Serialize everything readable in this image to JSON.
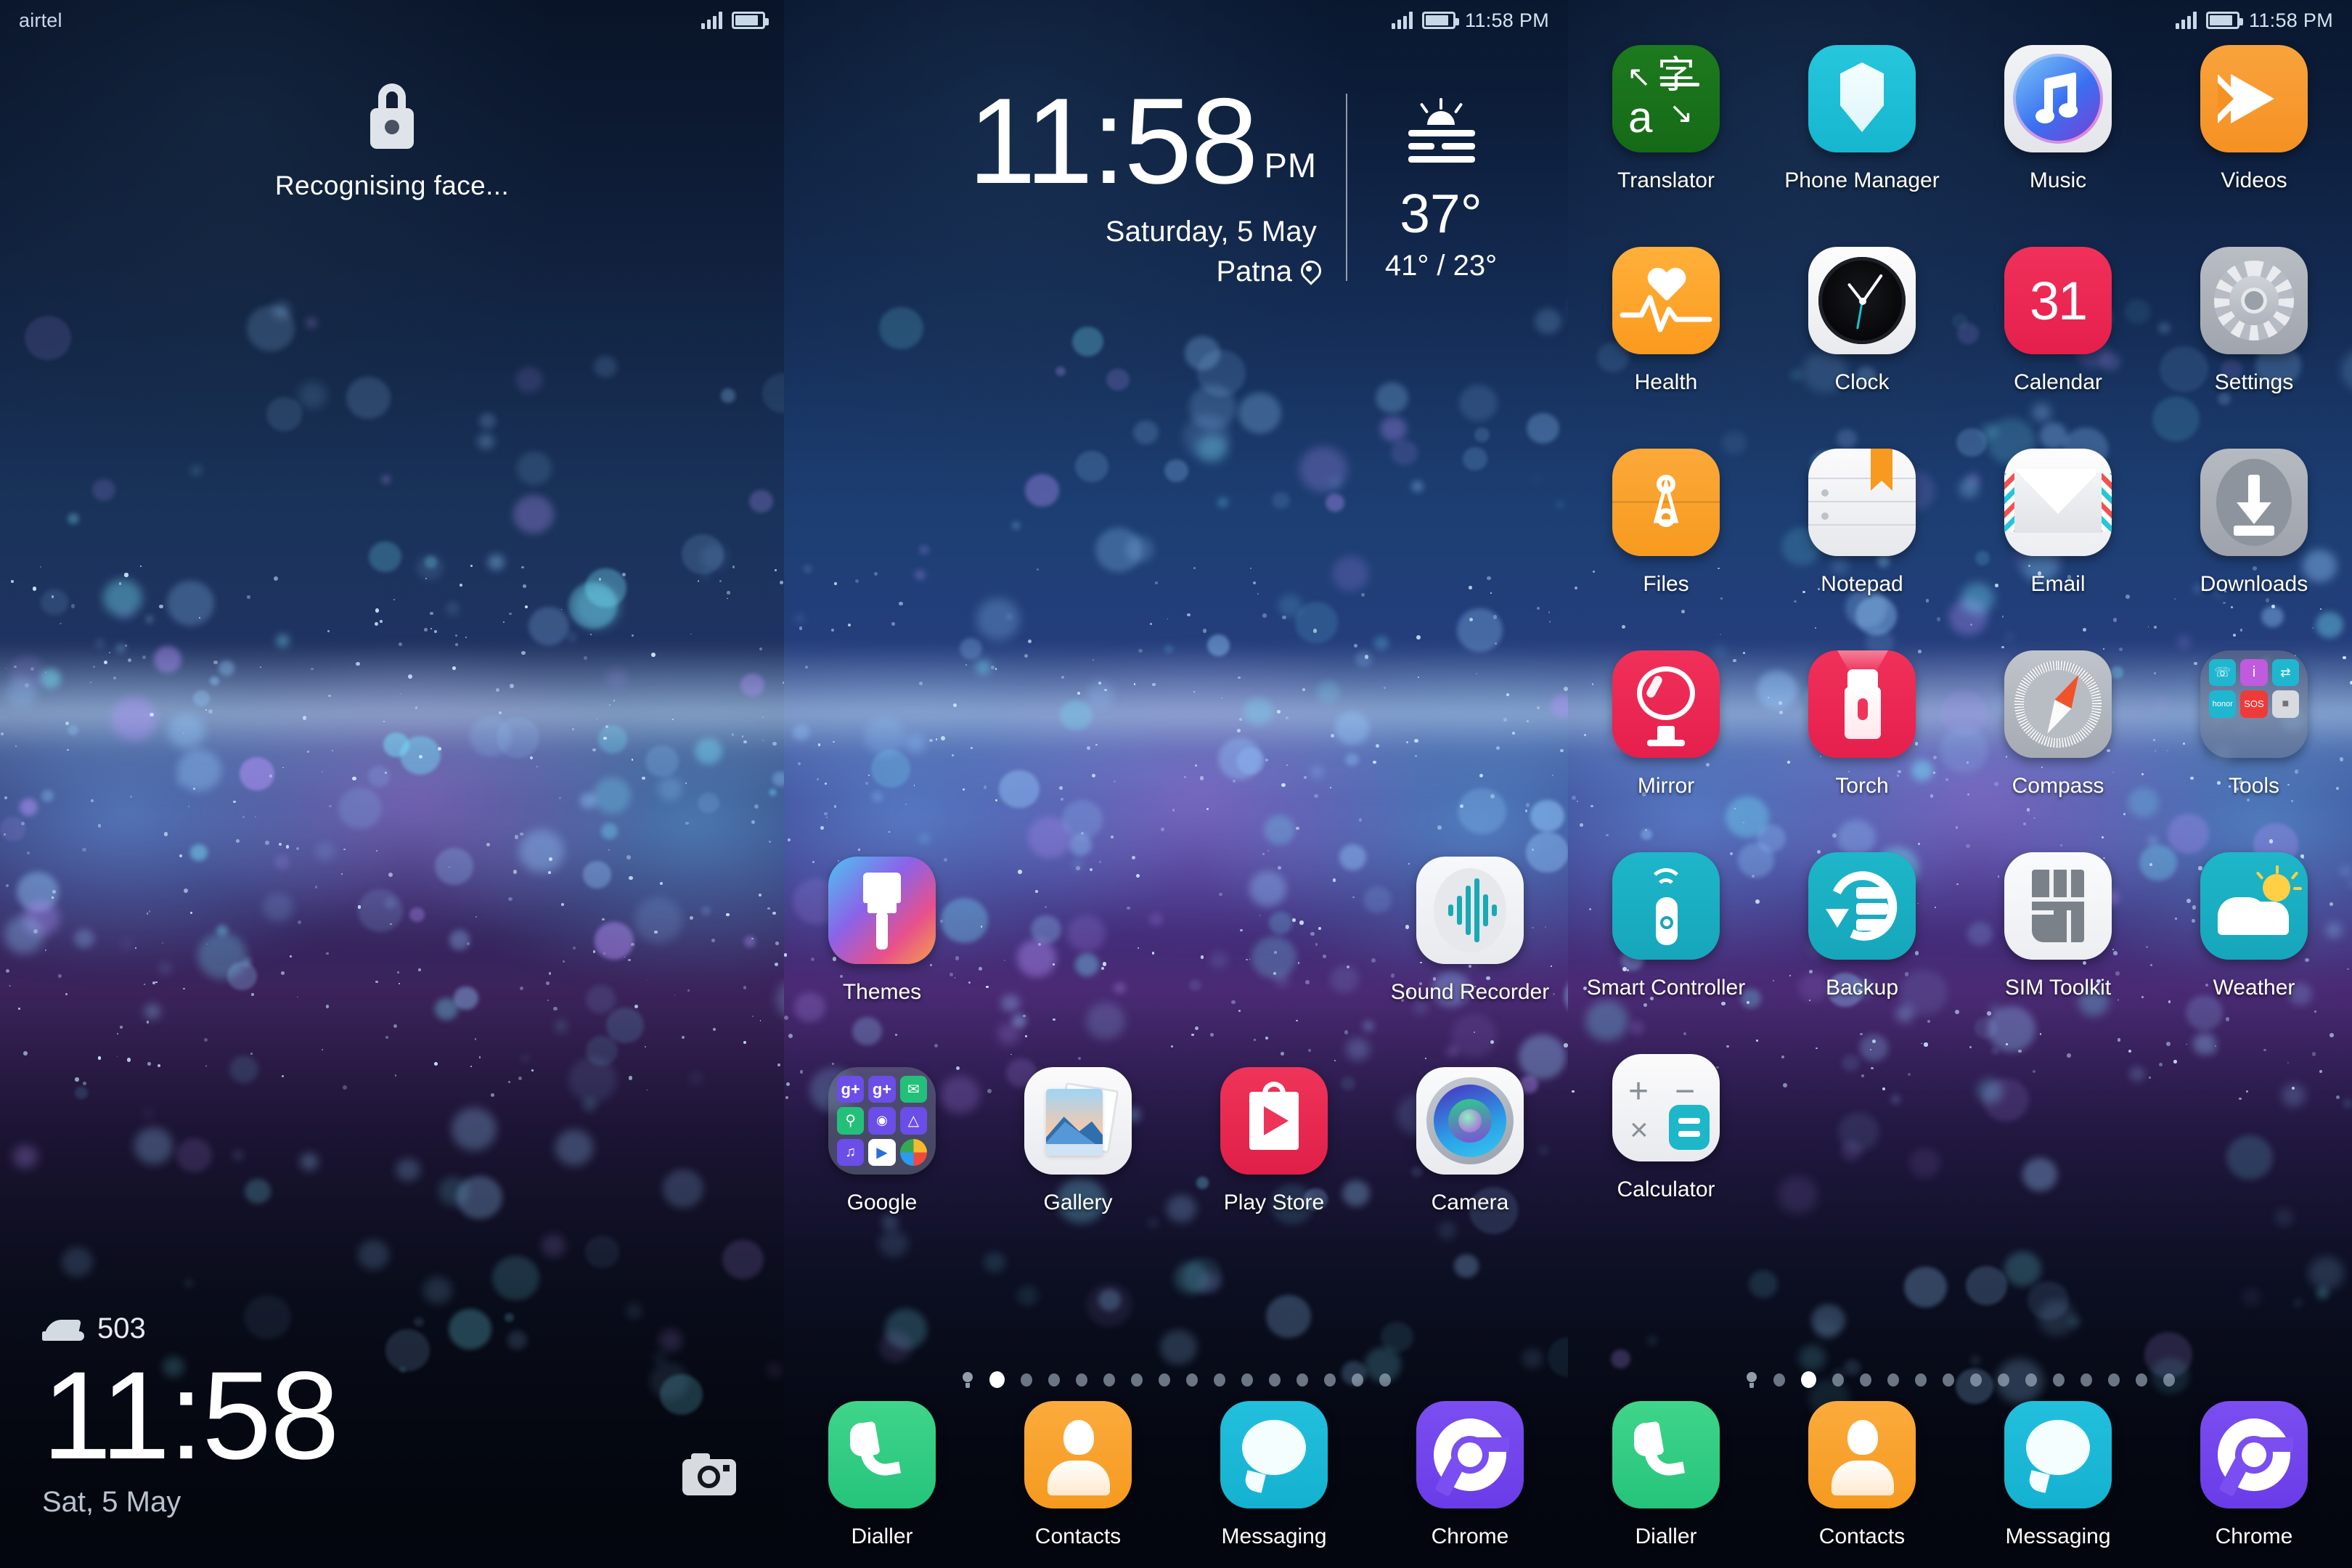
{
  "screens": [
    {
      "id": "lockscreen",
      "status_bar": {
        "carrier": "airtel",
        "signal_icon": "signal-bars-icon",
        "battery_icon": "battery-icon",
        "time": ""
      },
      "lock": {
        "lock_icon": "padlock-icon",
        "message": "Recognising face...",
        "steps_icon": "shoe-icon",
        "steps_count": "503",
        "clock": "11:58",
        "date": "Sat, 5 May",
        "camera_shortcut_icon": "camera-icon"
      }
    },
    {
      "id": "homescreen",
      "status_bar": {
        "carrier": "",
        "signal_icon": "signal-bars-icon",
        "battery_icon": "battery-icon",
        "time": "11:58 PM"
      },
      "widget": {
        "time": "11:58",
        "meridiem": "PM",
        "date": "Saturday, 5 May",
        "location": "Patna",
        "location_icon": "location-pin-icon",
        "weather_icon": "sunrise-haze-icon",
        "temperature": "37°",
        "range": "41° / 23°"
      },
      "apps": [
        {
          "label": "Themes",
          "icon": "themes-icon",
          "cls": "i-themes"
        },
        {
          "label": "",
          "icon": "",
          "cls": "empty"
        },
        {
          "label": "",
          "icon": "",
          "cls": "empty"
        },
        {
          "label": "Sound Recorder",
          "icon": "sound-recorder-icon",
          "cls": "i-sound"
        },
        {
          "label": "Google",
          "icon": "google-folder-icon",
          "cls": "i-gfolder"
        },
        {
          "label": "Gallery",
          "icon": "gallery-icon",
          "cls": "i-gallery"
        },
        {
          "label": "Play Store",
          "icon": "play-store-icon",
          "cls": "i-play"
        },
        {
          "label": "Camera",
          "icon": "camera-app-icon",
          "cls": "i-camera"
        }
      ],
      "page_indicator": {
        "home_icon": "bulb-icon",
        "total": 15,
        "active": 1
      },
      "dock": [
        {
          "label": "Dialler",
          "icon": "phone-handset-icon",
          "cls": "i-dialler"
        },
        {
          "label": "Contacts",
          "icon": "person-icon",
          "cls": "i-contacts"
        },
        {
          "label": "Messaging",
          "icon": "speech-bubble-icon",
          "cls": "i-msg"
        },
        {
          "label": "Chrome",
          "icon": "chrome-icon",
          "cls": "i-chrome"
        }
      ]
    },
    {
      "id": "homescreen-page2",
      "status_bar": {
        "carrier": "",
        "signal_icon": "signal-bars-icon",
        "battery_icon": "battery-icon",
        "time": "11:58 PM"
      },
      "apps": [
        {
          "label": "Translator",
          "icon": "translator-icon",
          "cls": "i-translator"
        },
        {
          "label": "Phone Manager",
          "icon": "shield-icon",
          "cls": "i-phonemgr"
        },
        {
          "label": "Music",
          "icon": "music-note-icon",
          "cls": "i-music"
        },
        {
          "label": "Videos",
          "icon": "play-arrow-icon",
          "cls": "i-videos"
        },
        {
          "label": "Health",
          "icon": "heart-pulse-icon",
          "cls": "i-health"
        },
        {
          "label": "Clock",
          "icon": "analog-clock-icon",
          "cls": "i-clock"
        },
        {
          "label": "Calendar",
          "icon": "calendar-31-icon",
          "cls": "i-calendar"
        },
        {
          "label": "Settings",
          "icon": "gear-icon",
          "cls": "i-settings"
        },
        {
          "label": "Files",
          "icon": "file-folder-icon",
          "cls": "i-files"
        },
        {
          "label": "Notepad",
          "icon": "notepad-icon",
          "cls": "i-notepad"
        },
        {
          "label": "Email",
          "icon": "envelope-icon",
          "cls": "i-email"
        },
        {
          "label": "Downloads",
          "icon": "download-arrow-icon",
          "cls": "i-downloads"
        },
        {
          "label": "Mirror",
          "icon": "mirror-icon",
          "cls": "i-mirror"
        },
        {
          "label": "Torch",
          "icon": "flashlight-icon",
          "cls": "i-torch"
        },
        {
          "label": "Compass",
          "icon": "compass-icon",
          "cls": "i-compass"
        },
        {
          "label": "Tools",
          "icon": "folder-icon",
          "cls": "i-folder"
        },
        {
          "label": "Smart Controller",
          "icon": "remote-control-icon",
          "cls": "i-smartctl"
        },
        {
          "label": "Backup",
          "icon": "backup-restore-icon",
          "cls": "i-backup"
        },
        {
          "label": "SIM Toolkit",
          "icon": "sim-card-icon",
          "cls": "i-sim"
        },
        {
          "label": "Weather",
          "icon": "cloud-sun-icon",
          "cls": "i-weather"
        },
        {
          "label": "Calculator",
          "icon": "calculator-icon",
          "cls": "i-calc"
        },
        {
          "label": "",
          "icon": "",
          "cls": "empty"
        },
        {
          "label": "",
          "icon": "",
          "cls": "empty"
        },
        {
          "label": "",
          "icon": "",
          "cls": "empty"
        }
      ],
      "tools_folder_items": [
        "phone-clone",
        "info",
        "sim-transfer",
        "honor",
        "SOS",
        "sim-card"
      ],
      "page_indicator": {
        "home_icon": "bulb-icon",
        "total": 15,
        "active": 2
      },
      "dock": [
        {
          "label": "Dialler",
          "icon": "phone-handset-icon",
          "cls": "i-dialler"
        },
        {
          "label": "Contacts",
          "icon": "person-icon",
          "cls": "i-contacts"
        },
        {
          "label": "Messaging",
          "icon": "speech-bubble-icon",
          "cls": "i-msg"
        },
        {
          "label": "Chrome",
          "icon": "chrome-icon",
          "cls": "i-chrome"
        }
      ]
    }
  ],
  "colors": {
    "accent_teal": "#1eb6c9",
    "accent_red": "#ef3459",
    "accent_orange": "#f79a1f",
    "accent_green": "#1d7a1e",
    "accent_purple": "#7a4ef0",
    "text_primary": "#ffffff",
    "text_secondary": "#b9c3cf"
  }
}
